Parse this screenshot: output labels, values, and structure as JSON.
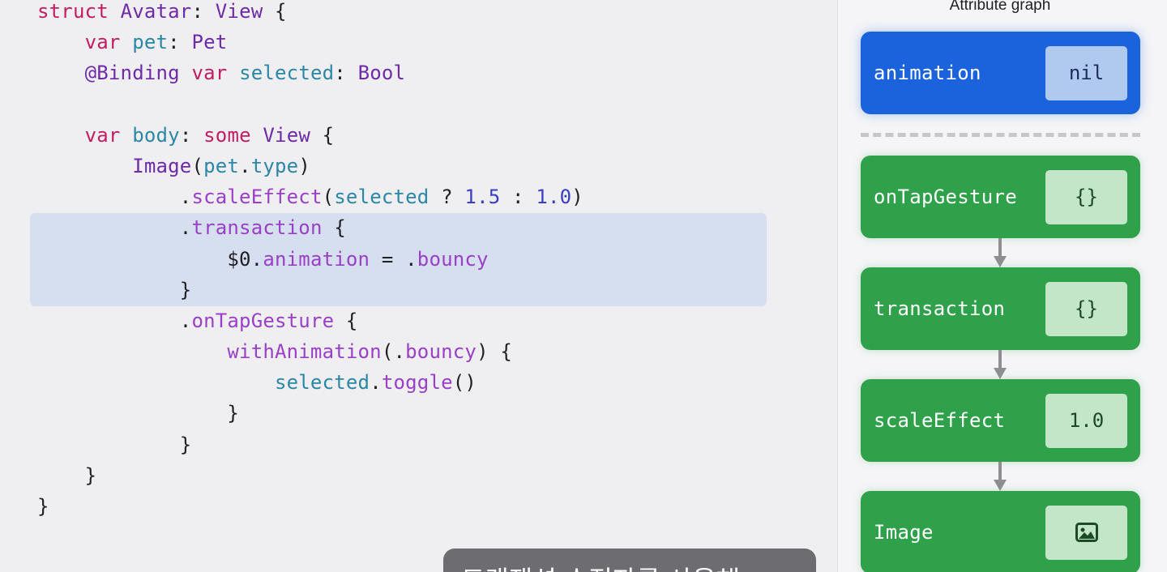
{
  "code": {
    "lines": [
      [
        [
          "struct",
          "tk-keyword"
        ],
        [
          " ",
          "tk-punct"
        ],
        [
          "Avatar",
          "tk-type"
        ],
        [
          ": ",
          "tk-punct"
        ],
        [
          "View",
          "tk-type"
        ],
        [
          " {",
          "tk-punct"
        ]
      ],
      [
        [
          "    ",
          "tk-punct"
        ],
        [
          "var",
          "tk-keyword"
        ],
        [
          " ",
          "tk-punct"
        ],
        [
          "pet",
          "tk-prop"
        ],
        [
          ": ",
          "tk-punct"
        ],
        [
          "Pet",
          "tk-type"
        ]
      ],
      [
        [
          "    ",
          "tk-punct"
        ],
        [
          "@Binding",
          "tk-type"
        ],
        [
          " ",
          "tk-punct"
        ],
        [
          "var",
          "tk-keyword"
        ],
        [
          " ",
          "tk-punct"
        ],
        [
          "selected",
          "tk-prop"
        ],
        [
          ": ",
          "tk-punct"
        ],
        [
          "Bool",
          "tk-type"
        ]
      ],
      [
        [
          "",
          "tk-punct"
        ]
      ],
      [
        [
          "    ",
          "tk-punct"
        ],
        [
          "var",
          "tk-keyword"
        ],
        [
          " ",
          "tk-punct"
        ],
        [
          "body",
          "tk-prop"
        ],
        [
          ": ",
          "tk-punct"
        ],
        [
          "some",
          "tk-keyword"
        ],
        [
          " ",
          "tk-punct"
        ],
        [
          "View",
          "tk-type"
        ],
        [
          " {",
          "tk-punct"
        ]
      ],
      [
        [
          "        ",
          "tk-punct"
        ],
        [
          "Image",
          "tk-type"
        ],
        [
          "(",
          "tk-punct"
        ],
        [
          "pet",
          "tk-prop"
        ],
        [
          ".",
          "tk-punct"
        ],
        [
          "type",
          "tk-prop"
        ],
        [
          ")",
          "tk-punct"
        ]
      ],
      [
        [
          "            .",
          "tk-punct"
        ],
        [
          "scaleEffect",
          "tk-member"
        ],
        [
          "(",
          "tk-punct"
        ],
        [
          "selected",
          "tk-prop"
        ],
        [
          " ? ",
          "tk-punct"
        ],
        [
          "1.5",
          "tk-num"
        ],
        [
          " : ",
          "tk-punct"
        ],
        [
          "1.0",
          "tk-num"
        ],
        [
          ")",
          "tk-punct"
        ]
      ],
      [
        [
          "            .",
          "tk-punct"
        ],
        [
          "transaction",
          "tk-member"
        ],
        [
          " {",
          "tk-punct"
        ]
      ],
      [
        [
          "                $0.",
          "tk-punct"
        ],
        [
          "animation",
          "tk-member"
        ],
        [
          " = .",
          "tk-punct"
        ],
        [
          "bouncy",
          "tk-member"
        ]
      ],
      [
        [
          "            }",
          "tk-punct"
        ]
      ],
      [
        [
          "            .",
          "tk-punct"
        ],
        [
          "onTapGesture",
          "tk-member"
        ],
        [
          " {",
          "tk-punct"
        ]
      ],
      [
        [
          "                ",
          "tk-punct"
        ],
        [
          "withAnimation",
          "tk-member"
        ],
        [
          "(.",
          "tk-punct"
        ],
        [
          "bouncy",
          "tk-member"
        ],
        [
          ") {",
          "tk-punct"
        ]
      ],
      [
        [
          "                    ",
          "tk-punct"
        ],
        [
          "selected",
          "tk-prop"
        ],
        [
          ".",
          "tk-punct"
        ],
        [
          "toggle",
          "tk-member"
        ],
        [
          "()",
          "tk-punct"
        ]
      ],
      [
        [
          "                }",
          "tk-punct"
        ]
      ],
      [
        [
          "            }",
          "tk-punct"
        ]
      ],
      [
        [
          "    }",
          "tk-punct"
        ]
      ],
      [
        [
          "}",
          "tk-punct"
        ]
      ]
    ]
  },
  "graph": {
    "title": "Attribute graph",
    "animation_node": {
      "name": "animation",
      "value": "nil"
    },
    "nodes": [
      {
        "name": "onTapGesture",
        "value": "{}"
      },
      {
        "name": "transaction",
        "value": "{}"
      },
      {
        "name": "scaleEffect",
        "value": "1.0"
      },
      {
        "name": "Image",
        "icon": "photo-icon"
      }
    ]
  },
  "subtitle": {
    "text": "트랜잭션 수정자를 사용해"
  },
  "colors": {
    "animation_node": "#1a63dd",
    "graph_node": "#2fa14a",
    "highlight": "#d6dfef"
  }
}
